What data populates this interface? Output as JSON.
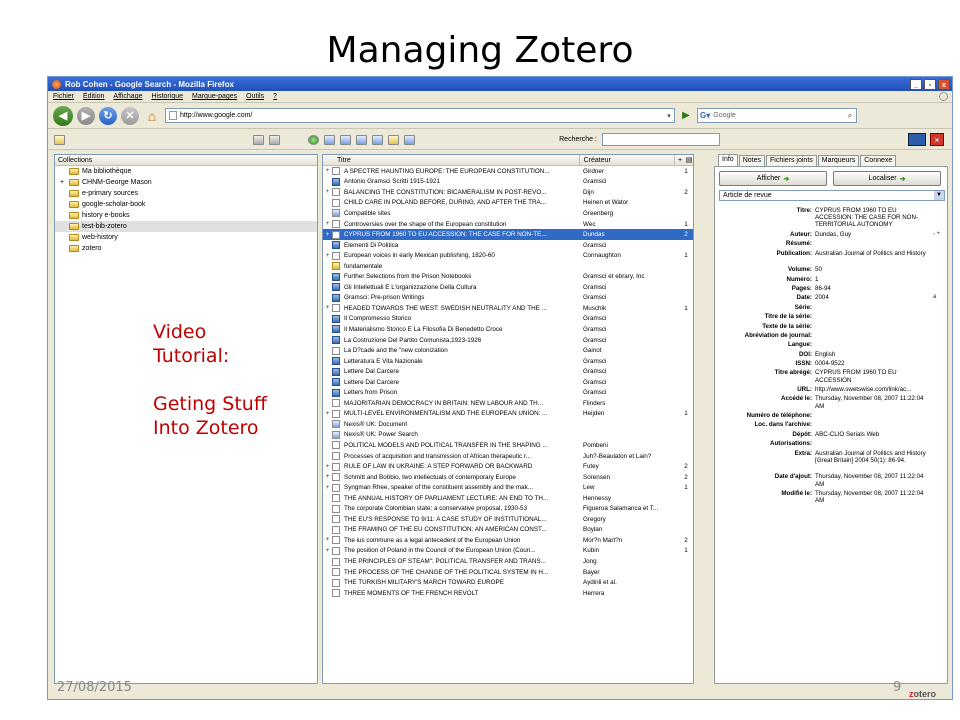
{
  "slide": {
    "title": "Managing Zotero",
    "date": "27/08/2015",
    "number": "9",
    "note_lines": [
      "Video",
      "Tutorial:",
      "",
      "Geting Stuff",
      "Into Zotero"
    ]
  },
  "window": {
    "title": "Rob Cohen - Google Search - Mozilla Firefox",
    "buttons": [
      "_",
      "▫",
      "x"
    ]
  },
  "menu": [
    "Fichier",
    "Édition",
    "Affichage",
    "Historique",
    "Marque-pages",
    "Outils",
    "?"
  ],
  "nav": {
    "url": "http://www.google.com/",
    "search_placeholder": "Google"
  },
  "zotero": {
    "search_label": "Recherche :",
    "collections_header": "Collections",
    "collections": [
      {
        "label": "Ma bibliothèque",
        "expand": "",
        "type": "library"
      },
      {
        "label": "CHNM-George Mason",
        "expand": "+",
        "type": "folder"
      },
      {
        "label": "e-primary sources",
        "expand": "",
        "type": "folder"
      },
      {
        "label": "google-scholar-book",
        "expand": "",
        "type": "folder"
      },
      {
        "label": "history e-books",
        "expand": "",
        "type": "folder"
      },
      {
        "label": "test-bib-zotero",
        "expand": "",
        "type": "folder",
        "selected": true
      },
      {
        "label": "web-history",
        "expand": "",
        "type": "folder"
      },
      {
        "label": "zotero",
        "expand": "",
        "type": "folder"
      }
    ],
    "items_headers": {
      "title": "Titre",
      "creator": "Créateur",
      "plus": "+"
    },
    "items": [
      {
        "exp": "+",
        "type": "doc",
        "title": "A SPECTRE HAUNTING EUROPE: THE EUROPEAN CONSTITUTION...",
        "creator": "Girdner",
        "count": "1"
      },
      {
        "exp": "",
        "type": "book",
        "title": "Antonio Gramsci Scritti 1915-1921",
        "creator": "Gramsci",
        "count": ""
      },
      {
        "exp": "+",
        "type": "doc",
        "title": "BALANCING THE CONSTITUTION: BICAMERALISM IN POST-REVO...",
        "creator": "Dijn",
        "count": "2"
      },
      {
        "exp": "",
        "type": "doc",
        "title": "CHILD CARE IN POLAND BEFORE, DURING, AND AFTER THE TRA...",
        "creator": "Heinen et Wator",
        "count": ""
      },
      {
        "exp": "",
        "type": "web",
        "title": "Compatible sites",
        "creator": "Greenberg",
        "count": ""
      },
      {
        "exp": "+",
        "type": "doc",
        "title": "Controversies over the shape of the European constitution",
        "creator": "Wec",
        "count": "1"
      },
      {
        "exp": "+",
        "type": "doc",
        "title": "CYPRUS FROM 1960 TO EU ACCESSION: THE CASE FOR NON-TE...",
        "creator": "Dundas",
        "count": "2",
        "selected": true
      },
      {
        "exp": "",
        "type": "book",
        "title": "Elementi Di Politica",
        "creator": "Gramsci",
        "count": ""
      },
      {
        "exp": "+",
        "type": "doc",
        "title": "European voices in early Mexican publishing, 1820-60",
        "creator": "Connaughton",
        "count": "1"
      },
      {
        "exp": "",
        "type": "folder",
        "title": "fondamentale",
        "creator": "",
        "count": ""
      },
      {
        "exp": "",
        "type": "book",
        "title": "Further Selections from the Prison Notebooks",
        "creator": "Gramsci et ebrary, Inc",
        "count": ""
      },
      {
        "exp": "",
        "type": "book",
        "title": "Gli Intellettuali E L'organizzazione Della Cultura",
        "creator": "Gramsci",
        "count": ""
      },
      {
        "exp": "",
        "type": "book",
        "title": "Gramsci: Pre-prison Writings",
        "creator": "Gramsci",
        "count": ""
      },
      {
        "exp": "+",
        "type": "doc",
        "title": "HEADED TOWARDS THE WEST: SWEDISH NEUTRALITY AND THE ...",
        "creator": "Muschik",
        "count": "1"
      },
      {
        "exp": "",
        "type": "book",
        "title": "Il Compromesso Storico",
        "creator": "Gramsci",
        "count": ""
      },
      {
        "exp": "",
        "type": "book",
        "title": "Il Materialismo Storico E La Filosofia Di Benedetto Croce",
        "creator": "Gramsci",
        "count": ""
      },
      {
        "exp": "",
        "type": "book",
        "title": "La Costruzione Del Partito Comunista,1923-1926",
        "creator": "Gramsci",
        "count": ""
      },
      {
        "exp": "",
        "type": "doc",
        "title": "La D?cade and the \"new colonization",
        "creator": "Gainot",
        "count": ""
      },
      {
        "exp": "",
        "type": "book",
        "title": "Letteratura E Vita Nazionale",
        "creator": "Gramsci",
        "count": ""
      },
      {
        "exp": "",
        "type": "book",
        "title": "Lettere Dal Carcere",
        "creator": "Gramsci",
        "count": ""
      },
      {
        "exp": "",
        "type": "book",
        "title": "Lettere Dal Carcere",
        "creator": "Gramsci",
        "count": ""
      },
      {
        "exp": "",
        "type": "book",
        "title": "Letters from Prison",
        "creator": "Gramsci",
        "count": ""
      },
      {
        "exp": "",
        "type": "doc",
        "title": "MAJORITARIAN DEMOCRACY IN BRITAIN: NEW LABOUR AND TH...",
        "creator": "Flinders",
        "count": ""
      },
      {
        "exp": "+",
        "type": "doc",
        "title": "MULTI-LEVEL ENVIRONMENTALISM AND THE EUROPEAN UNION: ...",
        "creator": "Heijden",
        "count": "1"
      },
      {
        "exp": "",
        "type": "web",
        "title": "Nexis® UK: Document",
        "creator": "",
        "count": ""
      },
      {
        "exp": "",
        "type": "web",
        "title": "Nexis® UK: Power Search",
        "creator": "",
        "count": ""
      },
      {
        "exp": "",
        "type": "doc",
        "title": "POLITICAL MODELS AND POLITICAL TRANSFER IN THE SHAPING ...",
        "creator": "Pombeni",
        "count": ""
      },
      {
        "exp": "",
        "type": "doc",
        "title": "Processes of acquisition and transmission of African therapeutic r...",
        "creator": "Juh?-Beaulaton et Lain?",
        "count": ""
      },
      {
        "exp": "+",
        "type": "doc",
        "title": "RULE OF LAW IN UKRAINE: A STEP FORWARD OR BACKWARD",
        "creator": "Futey",
        "count": "2"
      },
      {
        "exp": "+",
        "type": "doc",
        "title": "Schmitt and Bobbio, two intellectuals of contemporary Europe",
        "creator": "Sorensen",
        "count": "2"
      },
      {
        "exp": "+",
        "type": "doc",
        "title": "Syngman Rhee, speaker of the constituent assembly and the mak...",
        "creator": "Lew",
        "count": "1"
      },
      {
        "exp": "",
        "type": "doc",
        "title": "THE ANNUAL HISTORY OF PARLIAMENT LECTURE: AN END TO TH...",
        "creator": "Hennessy",
        "count": ""
      },
      {
        "exp": "",
        "type": "doc",
        "title": "The corporate Colombian state: a conservative proposal, 1930-53",
        "creator": "Figueroa Salamanca et T...",
        "count": ""
      },
      {
        "exp": "",
        "type": "doc",
        "title": "THE EU'S RESPONSE TO 9/11: A CASE STUDY OF INSTITUTIONAL...",
        "creator": "Gregory",
        "count": ""
      },
      {
        "exp": "",
        "type": "doc",
        "title": "THE FRAMING OF THE EU CONSTITUTION: AN AMERICAN CONST...",
        "creator": "Boylan",
        "count": ""
      },
      {
        "exp": "+",
        "type": "doc",
        "title": "The ius commune as a legal antecedent of the European Union",
        "creator": "Mor?n Mart?n",
        "count": "2"
      },
      {
        "exp": "+",
        "type": "doc",
        "title": "The position of Poland in the Council of the European Union (Coun...",
        "creator": "Kubin",
        "count": "1"
      },
      {
        "exp": "",
        "type": "doc",
        "title": "THE PRINCIPLES OF STEAM\": POLITICAL TRANSFER AND TRANS...",
        "creator": "Jong",
        "count": ""
      },
      {
        "exp": "",
        "type": "doc",
        "title": "THE PROCESS OF THE CHANGE OF THE POLITICAL SYSTEM IN H...",
        "creator": "Bayer",
        "count": ""
      },
      {
        "exp": "",
        "type": "doc",
        "title": "THE TURKISH MILITARY'S MARCH TOWARD EUROPE",
        "creator": "Aydinli et al.",
        "count": ""
      },
      {
        "exp": "",
        "type": "doc",
        "title": "THREE MOMENTS OF THE FRENCH REVOLT",
        "creator": "Herrera",
        "count": ""
      }
    ],
    "tabs": [
      "Info",
      "Notes",
      "Fichiers joints",
      "Marqueurs",
      "Connexe"
    ],
    "afficher_label": "Afficher",
    "localiser_label": "Localiser",
    "item_type": "Article de revue",
    "fields": [
      {
        "label": "Titre:",
        "value": "CYPRUS FROM 1960 TO EU ACCESSION: THE CASE FOR NON-TERRITORIAL AUTONOMY",
        "lines": 3
      },
      {
        "label": "Auteur:",
        "value": "Dundas,  Guy",
        "extra": "- +",
        "lines": 1
      },
      {
        "label": "Résumé:",
        "value": "",
        "lines": 1
      },
      {
        "label": "Publication:",
        "value": "Australian Journal of Politics and History",
        "lines": 2
      },
      {
        "label": "Volume:",
        "value": "50",
        "lines": 1
      },
      {
        "label": "Numéro:",
        "value": "1",
        "lines": 1
      },
      {
        "label": "Pages:",
        "value": "86-94",
        "lines": 1
      },
      {
        "label": "Date:",
        "value": "2004",
        "extra": "a",
        "lines": 1
      },
      {
        "label": "Série:",
        "value": "",
        "lines": 1
      },
      {
        "label": "Titre de la série:",
        "value": "",
        "lines": 1
      },
      {
        "label": "Texte de la série:",
        "value": "",
        "lines": 1
      },
      {
        "label": "Abréviation de journal:",
        "value": "",
        "lines": 1
      },
      {
        "label": "Langue:",
        "value": "",
        "lines": 1
      },
      {
        "label": "DOI:",
        "value": "English",
        "lines": 1
      },
      {
        "label": "ISSN:",
        "value": "0004-9522",
        "lines": 1
      },
      {
        "label": "Titre abrégé:",
        "value": "CYPRUS FROM 1960 TO EU ACCESSION",
        "lines": 2
      },
      {
        "label": "URL:",
        "value": "http://www.swetswise.com/link/ac...",
        "lines": 1
      },
      {
        "label": "Accédé le:",
        "value": "Thursday, November 08, 2007 11:22:04 AM",
        "lines": 2
      },
      {
        "label": "Numéro de téléphone:",
        "value": "",
        "lines": 1
      },
      {
        "label": "Loc. dans l'archive:",
        "value": "",
        "lines": 1
      },
      {
        "label": "Dépôt:",
        "value": "ABC-CLIO Serials Web",
        "lines": 1
      },
      {
        "label": "Autorisations:",
        "value": "",
        "lines": 1
      },
      {
        "label": "Extra:",
        "value": "Australian Journal of Politics and History [Great Britain] 2004 50(1): 86-94.",
        "lines": 3
      },
      {
        "label": "Date d'ajout:",
        "value": "Thursday, November 08, 2007 11:22:04 AM",
        "lines": 2
      },
      {
        "label": "Modifié le:",
        "value": "Thursday, November 08, 2007 11:22:04 AM",
        "lines": 2
      }
    ],
    "logo": "zotero"
  }
}
